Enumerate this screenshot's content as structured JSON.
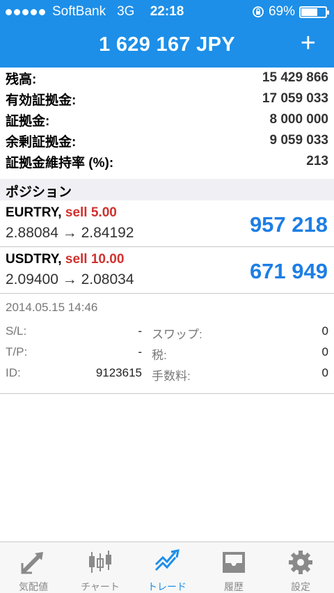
{
  "status_bar": {
    "carrier": "SoftBank",
    "network": "3G",
    "time": "22:18",
    "battery": "69%",
    "battery_level": 0.69
  },
  "header": {
    "balance": "1 629 167 JPY",
    "plus_symbol": "+"
  },
  "summary": [
    {
      "label": "残高:",
      "value": "15 429 866"
    },
    {
      "label": "有効証拠金:",
      "value": "17 059 033"
    },
    {
      "label": "証拠金:",
      "value": "8 000 000"
    },
    {
      "label": "余剰証拠金:",
      "value": "9 059 033"
    },
    {
      "label": "証拠金維持率 (%):",
      "value": "213"
    }
  ],
  "section_title": "ポジション",
  "positions": [
    {
      "symbol": "EURTRY,",
      "action": "sell 5.00",
      "prices": "2.88084 → 2.84192",
      "profit": "957 218"
    },
    {
      "symbol": "USDTRY,",
      "action": "sell 10.00",
      "prices": "2.09400 → 2.08034",
      "profit": "671 949"
    }
  ],
  "detail": {
    "date": "2014.05.15 14:46",
    "rows": [
      {
        "label1": "S/L:",
        "value1": "-",
        "label2": "スワップ:",
        "value2": "0"
      },
      {
        "label1": "T/P:",
        "value1": "-",
        "label2": "税:",
        "value2": "0"
      },
      {
        "label1": "ID:",
        "value1": "9123615",
        "label2": "手数料:",
        "value2": "0"
      }
    ]
  },
  "tabs": [
    {
      "label": "気配値",
      "icon": "quotes-icon"
    },
    {
      "label": "チャート",
      "icon": "chart-icon"
    },
    {
      "label": "トレード",
      "icon": "trade-icon"
    },
    {
      "label": "履歴",
      "icon": "history-icon"
    },
    {
      "label": "設定",
      "icon": "settings-icon"
    }
  ],
  "colors": {
    "accent": "#1d8fe8",
    "sell": "#d0312d",
    "profit": "#1d7ee5"
  }
}
